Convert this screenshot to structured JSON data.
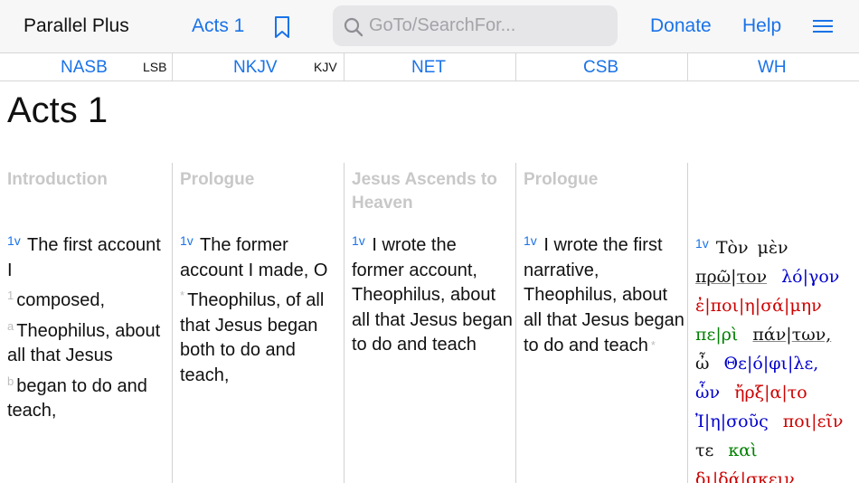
{
  "header": {
    "app_name": "Parallel Plus",
    "chapter": "Acts 1",
    "search_placeholder": "GoTo/SearchFor...",
    "donate": "Donate",
    "help": "Help"
  },
  "versions": [
    {
      "name": "NASB",
      "alt": "LSB"
    },
    {
      "name": "NKJV",
      "alt": "KJV"
    },
    {
      "name": "NET",
      "alt": ""
    },
    {
      "name": "CSB",
      "alt": ""
    },
    {
      "name": "WH",
      "alt": ""
    }
  ],
  "page_title": "Acts 1",
  "columns": [
    {
      "heading": "Introduction",
      "verse_num": "1",
      "verse_arrow": "v"
    },
    {
      "heading": "Prologue",
      "verse_num": "1",
      "verse_arrow": "v",
      "text": "The former account I made, O",
      "fn": "*",
      "text2": "Theophilus, of all that Jesus began both to do and teach,"
    },
    {
      "heading": "Jesus Ascends to Heaven",
      "verse_num": "1",
      "verse_arrow": "v",
      "text": "I wrote the former account, Theophilus, about all that Jesus began to do and teach"
    },
    {
      "heading": "Prologue",
      "verse_num": "1",
      "verse_arrow": "v",
      "text": "I wrote the first narrative, Theophilus, about all that Jesus began to do and teach",
      "fn": "*"
    },
    {
      "heading": "",
      "verse_num": "1",
      "verse_arrow": "v"
    }
  ],
  "nasb": {
    "part1": "The first account I",
    "fn1": "1",
    "part2": "composed,",
    "fn2": "a",
    "part3": "Theophilus, about all that Jesus",
    "fn3": "b",
    "part4": "began to do and teach,"
  },
  "colors": {
    "blue": "#0000cc",
    "red": "#cc0000",
    "green": "#008000",
    "black": "#111111",
    "accent": "#1a73e8"
  },
  "greek": {
    "ton": "Τὸν",
    "men": "μὲν",
    "pro": "πρῶ",
    "ton2": "τον",
    "lo": "λό",
    "gon": "γον",
    "e": "ἐ",
    "poi": "ποι",
    "h1": "η",
    "sa": "σά",
    "mhn": "μην",
    "pe": "πε",
    "ri": "ρὶ",
    "pan": "πάν",
    "twn": "των,",
    "w": "ὦ",
    "the": "Θε",
    "o": "ό",
    "phi": "φι",
    "le": "λε,",
    "wn": "ὧν",
    "hrx": "ἤρξ",
    "a": "α",
    "to": "το",
    "i": "Ἰ",
    "h2": "η",
    "sous": "σοῦς",
    "poi2": "ποι",
    "ein": "εῖν",
    "te": "τε",
    "kai": "καὶ",
    "di": "δι",
    "da": "δά",
    "skein": "σκειν"
  }
}
